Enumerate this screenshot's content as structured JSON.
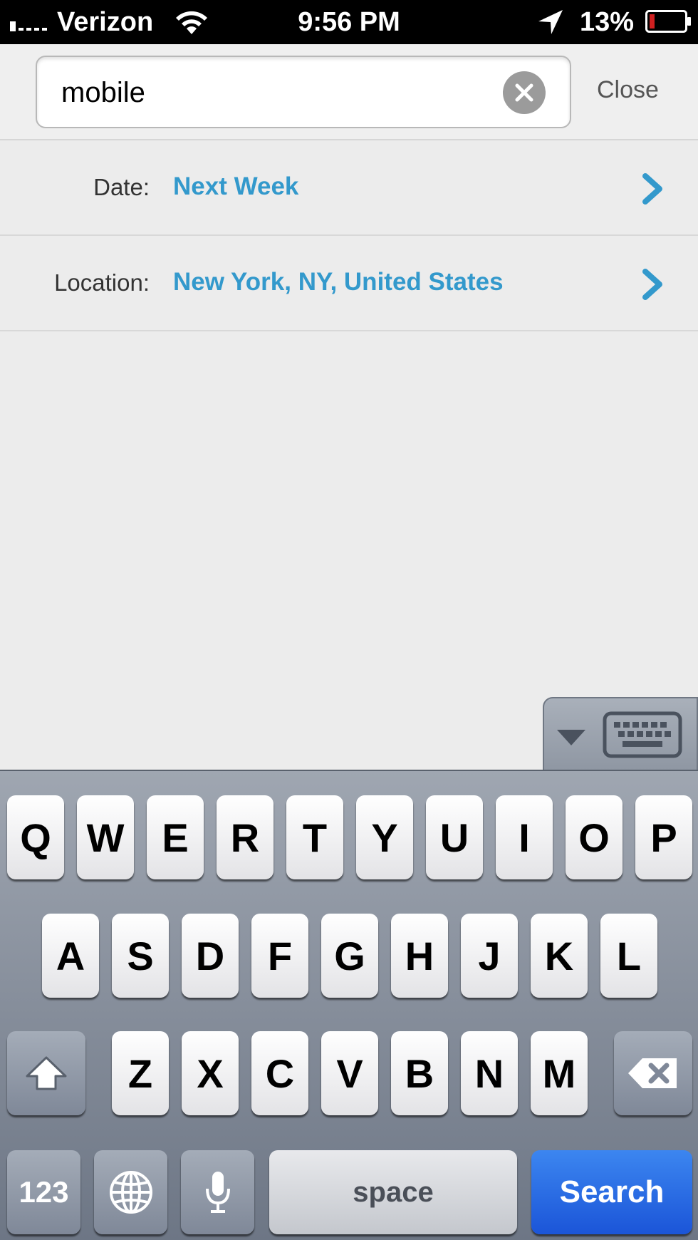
{
  "status_bar": {
    "carrier": "Verizon",
    "time": "9:56 PM",
    "battery_percent": "13%"
  },
  "search": {
    "query": "mobile",
    "close_label": "Close"
  },
  "filters": {
    "date": {
      "label": "Date:",
      "value": "Next Week"
    },
    "location": {
      "label": "Location:",
      "value": "New York, NY, United States"
    }
  },
  "keyboard": {
    "row1": [
      "Q",
      "W",
      "E",
      "R",
      "T",
      "Y",
      "U",
      "I",
      "O",
      "P"
    ],
    "row2": [
      "A",
      "S",
      "D",
      "F",
      "G",
      "H",
      "J",
      "K",
      "L"
    ],
    "row3": [
      "Z",
      "X",
      "C",
      "V",
      "B",
      "N",
      "M"
    ],
    "numbers_label": "123",
    "space_label": "space",
    "search_label": "Search"
  },
  "colors": {
    "accent_link": "#3399cc",
    "search_key": "#1b55d8",
    "battery_low": "#d02020"
  },
  "icons": {
    "signal": "signal-bars-icon",
    "wifi": "wifi-icon",
    "location": "location-arrow-icon",
    "battery": "battery-icon",
    "clear": "clear-circle-x-icon",
    "chevron": "chevron-right-icon",
    "shift": "shift-arrow-icon",
    "backspace": "backspace-icon",
    "globe": "globe-icon",
    "microphone": "microphone-icon",
    "hide_keyboard": "hide-keyboard-icon"
  }
}
